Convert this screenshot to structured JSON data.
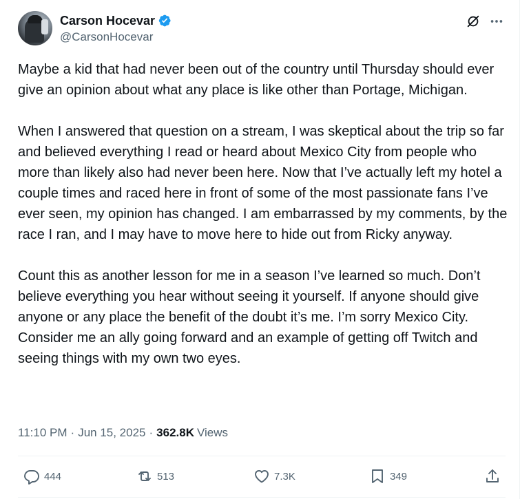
{
  "author": {
    "display_name": "Carson Hocevar",
    "handle": "@CarsonHocevar",
    "verified": true,
    "verified_color": "#1d9bf0"
  },
  "post": {
    "paragraphs": [
      "Maybe a kid that had never been out of the country until Thursday should ever give an opinion about what any place is like other than Portage, Michigan.",
      "When I answered that question on a stream, I was skeptical about the trip so far and believed everything I read or heard about Mexico City from people who more than likely also had never been here. Now that I’ve actually left my hotel a couple times and raced here in front of some of the most passionate fans I’ve ever seen, my opinion has changed. I am embarrassed by my comments, by the race I ran, and I may have to move here to hide out from Ricky anyway.",
      "Count this as another lesson for me in a season I’ve learned so much. Don’t believe everything you hear without seeing it yourself. If anyone should give anyone or any place the benefit of the doubt it’s me. I’m sorry Mexico City.  Consider me an ally going forward and an example of getting off Twitch and seeing things with my own two eyes."
    ],
    "time": "11:10 PM",
    "date": "Jun 15, 2025",
    "separator": "·",
    "views_count": "362.8K",
    "views_label": "Views"
  },
  "actions": {
    "replies": "444",
    "reposts": "513",
    "likes": "7.3K",
    "bookmarks": "349"
  },
  "icons": {
    "header": [
      "grok-icon",
      "more-icon"
    ],
    "actions": [
      "reply-icon",
      "repost-icon",
      "like-icon",
      "bookmark-icon",
      "share-icon"
    ]
  },
  "colors": {
    "text_primary": "#0f1419",
    "text_secondary": "#536471",
    "divider": "#eff3f4"
  }
}
